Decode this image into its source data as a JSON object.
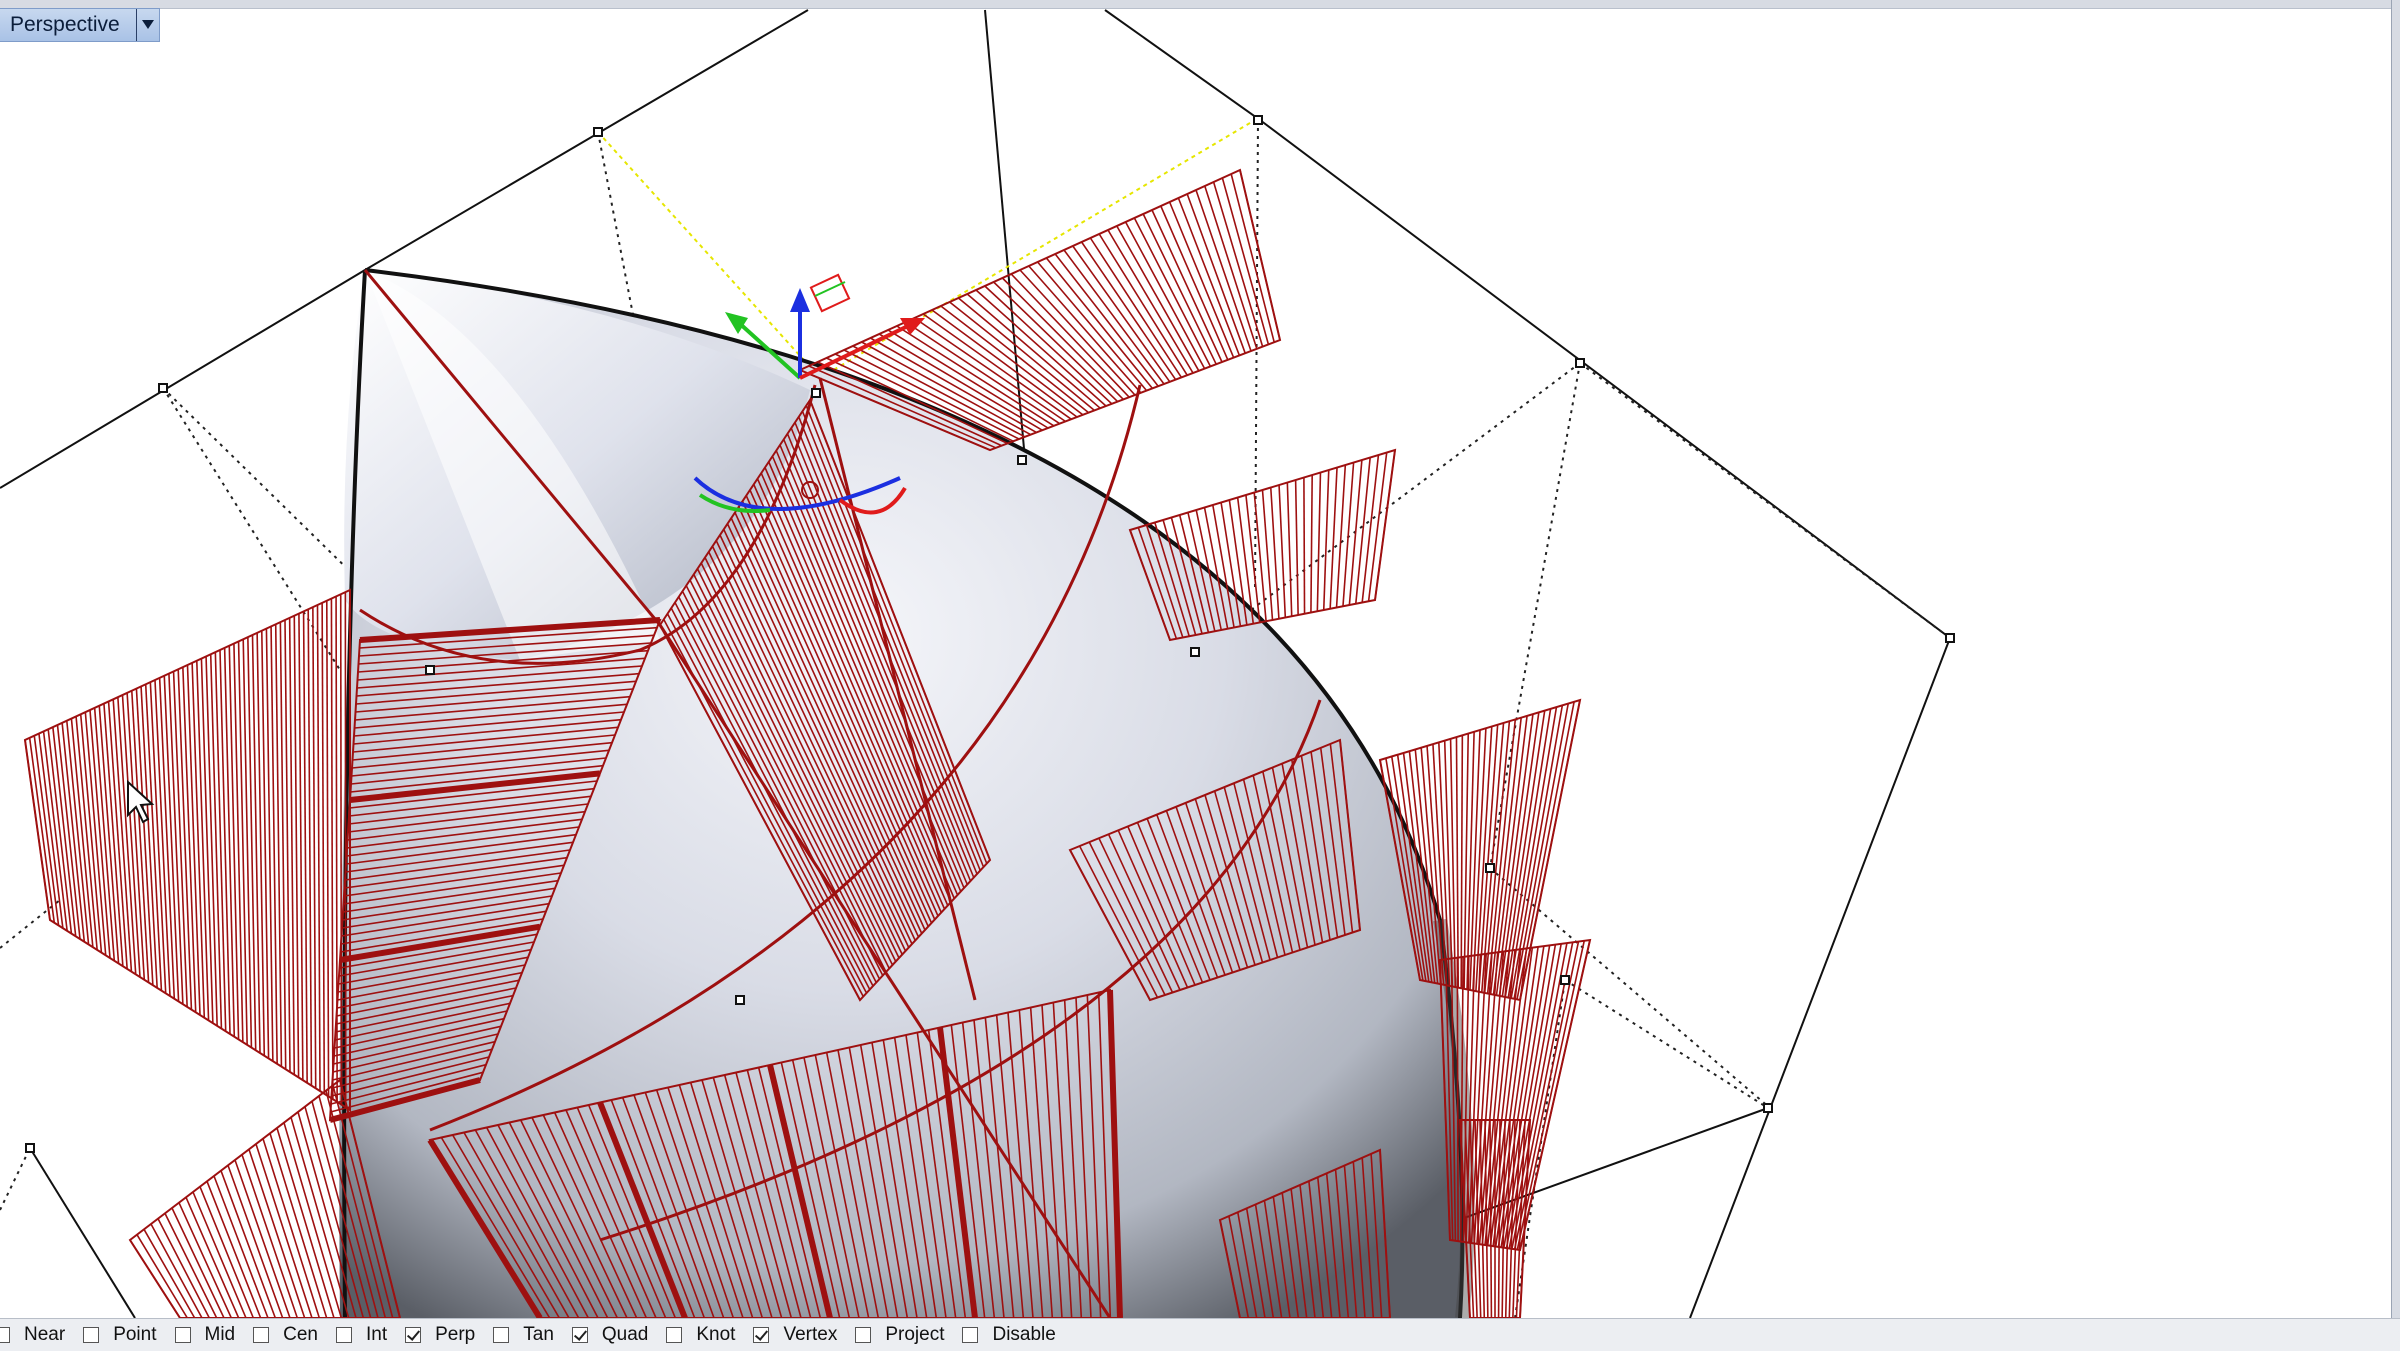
{
  "viewport": {
    "title": "Perspective",
    "dropdown_icon": "triangle-down-icon"
  },
  "osnaps": [
    {
      "label": "Near",
      "checked": false
    },
    {
      "label": "Point",
      "checked": false
    },
    {
      "label": "Mid",
      "checked": false
    },
    {
      "label": "Cen",
      "checked": false
    },
    {
      "label": "Int",
      "checked": false
    },
    {
      "label": "Perp",
      "checked": true
    },
    {
      "label": "Tan",
      "checked": false
    },
    {
      "label": "Quad",
      "checked": true
    },
    {
      "label": "Knot",
      "checked": false
    },
    {
      "label": "Vertex",
      "checked": true
    },
    {
      "label": "Project",
      "checked": false
    },
    {
      "label": "Disable",
      "checked": false
    }
  ],
  "colors": {
    "fins": "#9e1010",
    "gizmo_x": "#e01b1b",
    "gizmo_y": "#22c322",
    "gizmo_z": "#1b2fe0",
    "cage": "#111111",
    "selection": "#e6e600"
  }
}
